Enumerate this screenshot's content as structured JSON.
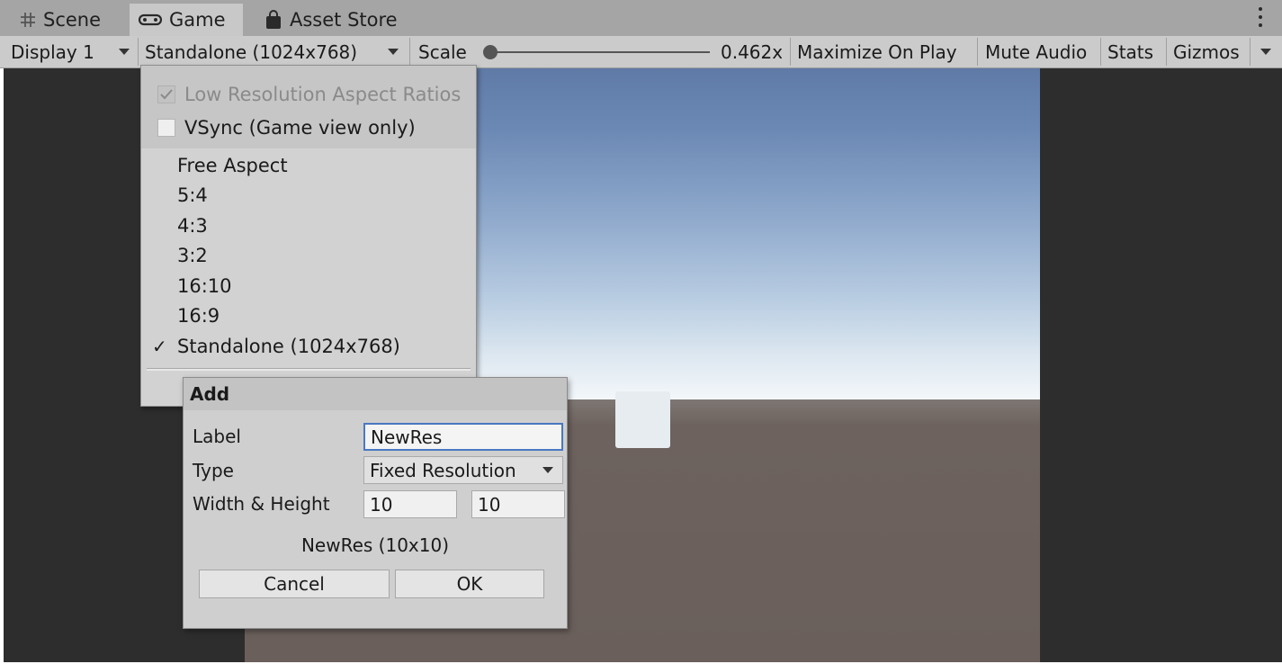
{
  "tabs": [
    {
      "label": "Scene",
      "icon": "grid-icon"
    },
    {
      "label": "Game",
      "icon": "gamepad-icon"
    },
    {
      "label": "Asset Store",
      "icon": "shopping-bag-icon"
    }
  ],
  "toolbar": {
    "display": "Display 1",
    "resolution": "Standalone (1024x768)",
    "scale_label": "Scale",
    "scale_value": "0.462x",
    "scale_fraction": 0.0,
    "maximize": "Maximize On Play",
    "mute": "Mute Audio",
    "stats": "Stats",
    "gizmos": "Gizmos"
  },
  "menu": {
    "low_res": {
      "label": "Low Resolution Aspect Ratios",
      "checked": true,
      "disabled": true
    },
    "vsync": {
      "label": "VSync (Game view only)",
      "checked": false
    },
    "items": [
      {
        "label": "Free Aspect",
        "checked": false
      },
      {
        "label": "5:4",
        "checked": false
      },
      {
        "label": "4:3",
        "checked": false
      },
      {
        "label": "3:2",
        "checked": false
      },
      {
        "label": "16:10",
        "checked": false
      },
      {
        "label": "16:9",
        "checked": false
      },
      {
        "label": "Standalone (1024x768)",
        "checked": true
      }
    ],
    "checkmark": "✓"
  },
  "dialog": {
    "title": "Add",
    "label_label": "Label",
    "label_value": "NewRes",
    "type_label": "Type",
    "type_value": "Fixed Resolution",
    "size_label": "Width & Height",
    "width": "10",
    "height": "10",
    "preview": "NewRes (10x10)",
    "cancel": "Cancel",
    "ok": "OK"
  }
}
